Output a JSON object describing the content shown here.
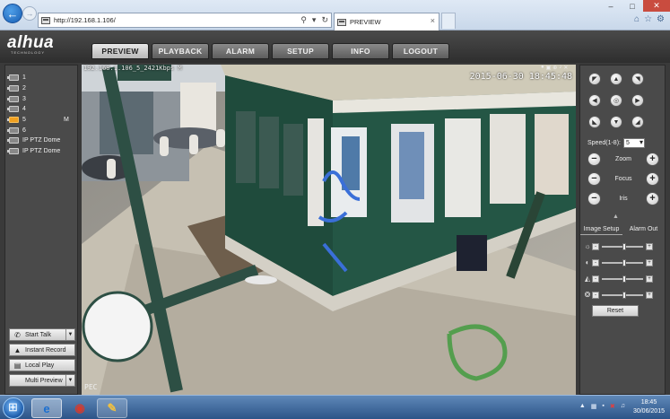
{
  "browser": {
    "address": "http://192.168.1.106/",
    "tab_title": "PREVIEW",
    "tab_close": "×"
  },
  "app": {
    "logo": "alhua",
    "logo_sub": "TECHNOLOGY",
    "tabs": [
      {
        "label": "PREVIEW",
        "active": true
      },
      {
        "label": "PLAYBACK"
      },
      {
        "label": "ALARM"
      },
      {
        "label": "SETUP"
      },
      {
        "label": "INFO"
      },
      {
        "label": "LOGOUT"
      }
    ]
  },
  "channels": [
    {
      "label": "1"
    },
    {
      "label": "2"
    },
    {
      "label": "3"
    },
    {
      "label": "4"
    },
    {
      "label": "5",
      "active": true,
      "mark": "M"
    },
    {
      "label": "6"
    },
    {
      "label": "IP PTZ Dome"
    },
    {
      "label": "IP PTZ Dome"
    }
  ],
  "left_buttons": [
    {
      "label": "Start Talk",
      "icon": "phone-icon",
      "dropdown": true
    },
    {
      "label": "Instant Record",
      "icon": "record-icon"
    },
    {
      "label": "Local Play",
      "icon": "film-icon"
    },
    {
      "label": "Multi Preview",
      "dropdown": true
    }
  ],
  "video": {
    "stream_info": "192.168.1.106_5_2421Kbps M",
    "timestamp": "2015-06-30 18:45:48",
    "label": "PEC"
  },
  "ptz": {
    "speed_label": "Speed(1-8):",
    "speed_value": "5",
    "zoom_label": "Zoom",
    "focus_label": "Focus",
    "iris_label": "Iris"
  },
  "image_panel": {
    "tab_setup": "Image Setup",
    "tab_alarm": "Alarm Out",
    "rows": [
      {
        "icon": "brightness-icon",
        "level": 0.55
      },
      {
        "icon": "contrast-icon",
        "level": 0.55
      },
      {
        "icon": "saturation-icon",
        "level": 0.55
      },
      {
        "icon": "hue-icon",
        "level": 0.55
      }
    ],
    "reset_label": "Reset"
  },
  "taskbar": {
    "time": "18:45",
    "date": "30/06/2015"
  },
  "colors": {
    "accent": "#f0a020",
    "panel": "#4a4a4a",
    "header": "#3a3a3a"
  }
}
